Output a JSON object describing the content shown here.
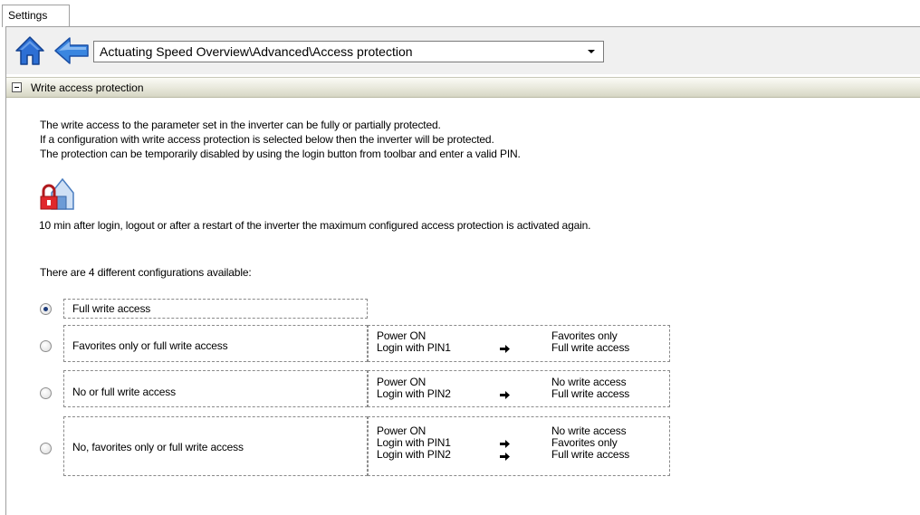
{
  "tab": {
    "label": "Settings"
  },
  "nav": {
    "path": "Actuating Speed Overview\\Advanced\\Access protection",
    "home_icon": "home-icon",
    "back_icon": "back-arrow-icon"
  },
  "section": {
    "title": "Write access protection"
  },
  "intro": {
    "line1": "The write access to the parameter set in the inverter can be fully or partially protected.",
    "line2": "If a configuration with write access protection is selected below then the inverter will be protected.",
    "line3": "The protection can be temporarily disabled by using the login button from toolbar and enter a valid PIN."
  },
  "timeout_note": "10 min after login, logout or after a restart of the inverter the maximum configured access protection is activated again.",
  "configs_heading": "There are 4 different configurations available:",
  "options": [
    {
      "label": "Full write access",
      "selected": true
    },
    {
      "label": "Favorites only or full write access",
      "selected": false,
      "conditions": [
        "Power ON",
        "Login with PIN1"
      ],
      "results": [
        "Favorites only",
        "Full write access"
      ]
    },
    {
      "label": "No or full write access",
      "selected": false,
      "conditions": [
        "Power ON",
        "Login with PIN2"
      ],
      "results": [
        "No write access",
        "Full write access"
      ]
    },
    {
      "label": "No, favorites only or full write access",
      "selected": false,
      "conditions": [
        "Power ON",
        "Login with PIN1",
        "Login with PIN2"
      ],
      "results": [
        "No write access",
        "Favorites only",
        "Full write access"
      ]
    }
  ],
  "colors": {
    "home_blue": "#2d6fd4",
    "lock_red": "#e0282c",
    "header_band": "#e6e6d8"
  }
}
